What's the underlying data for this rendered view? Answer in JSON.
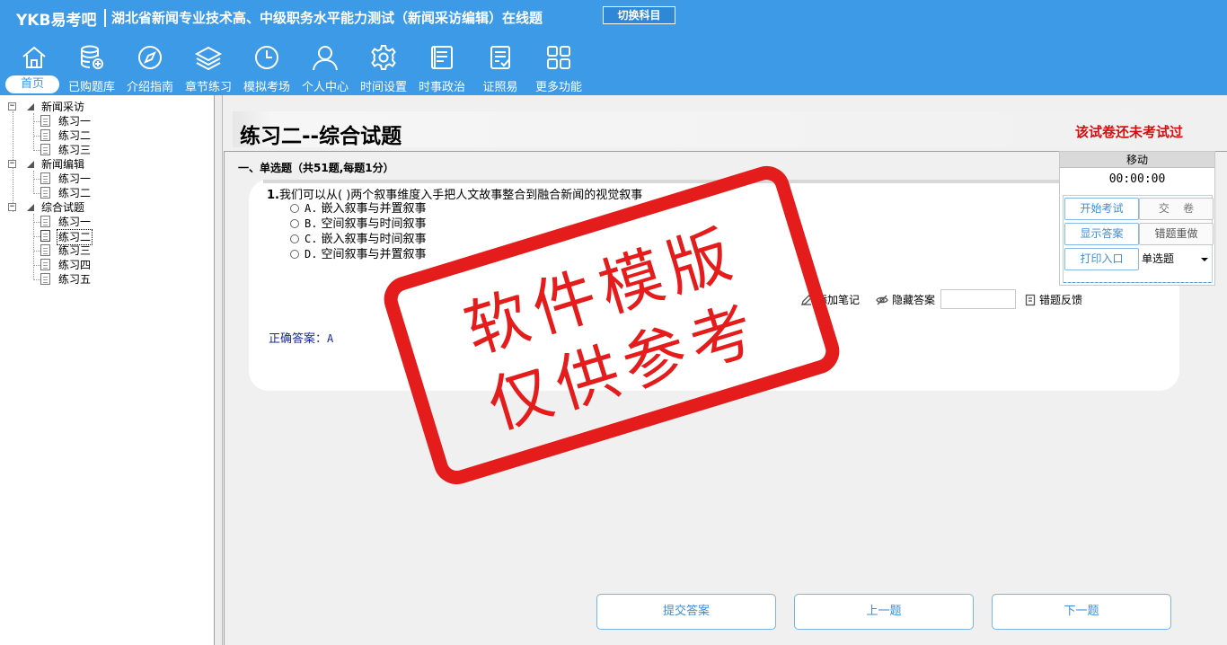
{
  "header": {
    "brand": "YKB易考吧",
    "title": "湖北省新闻专业技术高、中级职务水平能力测试（新闻采访编辑）在线题",
    "switch_button": "切换科目",
    "nav": [
      {
        "label": "首页",
        "icon": "home-icon"
      },
      {
        "label": "已购题库",
        "icon": "database-icon"
      },
      {
        "label": "介绍指南",
        "icon": "compass-icon"
      },
      {
        "label": "章节练习",
        "icon": "layers-icon"
      },
      {
        "label": "模拟考场",
        "icon": "clock-icon"
      },
      {
        "label": "个人中心",
        "icon": "user-icon"
      },
      {
        "label": "时间设置",
        "icon": "gear-icon"
      },
      {
        "label": "时事政治",
        "icon": "news-icon"
      },
      {
        "label": "证照易",
        "icon": "checklist-icon"
      },
      {
        "label": "更多功能",
        "icon": "grid-icon"
      }
    ]
  },
  "tree": {
    "groups": [
      {
        "label": "新闻采访",
        "items": [
          "练习一",
          "练习二",
          "练习三"
        ]
      },
      {
        "label": "新闻编辑",
        "items": [
          "练习一",
          "练习二"
        ]
      },
      {
        "label": "综合试题",
        "items": [
          "练习一",
          "练习二",
          "练习三",
          "练习四",
          "练习五"
        ]
      }
    ],
    "selected": "综合试题 / 练习二"
  },
  "paper": {
    "title": "练习二--综合试题",
    "status": "该试卷还未考试过",
    "section": "一、单选题（共51题,每题1分）"
  },
  "question": {
    "number": "1.",
    "stem": "我们可以从(  )两个叙事维度入手把人文故事整合到融合新闻的视觉叙事",
    "options": [
      {
        "key": "A.",
        "text": "嵌入叙事与并置叙事"
      },
      {
        "key": "B.",
        "text": "空间叙事与时间叙事"
      },
      {
        "key": "C.",
        "text": "嵌入叙事与时间叙事"
      },
      {
        "key": "D.",
        "text": "空间叙事与并置叙事"
      }
    ],
    "tools": {
      "note": "添加笔记",
      "hide_answer": "隐藏答案",
      "feedback": "错题反馈"
    },
    "answer_label": "正确答案：",
    "answer_value": "A"
  },
  "footer": {
    "submit": "提交答案",
    "prev": "上一题",
    "next": "下一题"
  },
  "panel": {
    "move": "移动",
    "timer": "00:00:00",
    "start": "开始考试",
    "hand_in": "交    卷",
    "show_answer": "显示答案",
    "redo_wrong": "错题重做",
    "print": "打印入口",
    "type_select": "单选题"
  },
  "watermark": {
    "line1": "软件模版",
    "line2": "仅供参考",
    "color": "#e41c1c"
  },
  "colors": {
    "header_bg": "#3c9ae6",
    "accent_red": "#d01010",
    "link_blue": "#3c8ed8"
  }
}
